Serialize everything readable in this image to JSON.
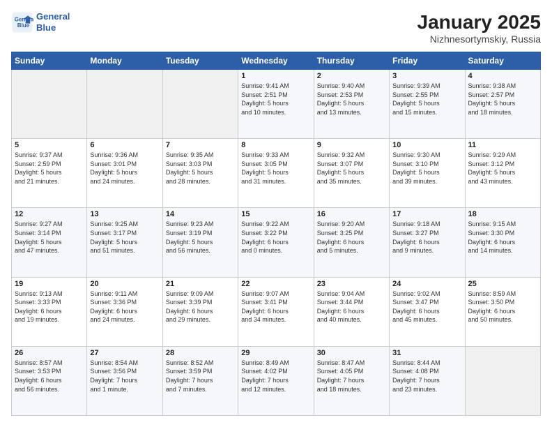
{
  "logo": {
    "line1": "General",
    "line2": "Blue"
  },
  "title": "January 2025",
  "subtitle": "Nizhnesortymskiy, Russia",
  "weekdays": [
    "Sunday",
    "Monday",
    "Tuesday",
    "Wednesday",
    "Thursday",
    "Friday",
    "Saturday"
  ],
  "weeks": [
    [
      {
        "day": "",
        "info": ""
      },
      {
        "day": "",
        "info": ""
      },
      {
        "day": "",
        "info": ""
      },
      {
        "day": "1",
        "info": "Sunrise: 9:41 AM\nSunset: 2:51 PM\nDaylight: 5 hours\nand 10 minutes."
      },
      {
        "day": "2",
        "info": "Sunrise: 9:40 AM\nSunset: 2:53 PM\nDaylight: 5 hours\nand 13 minutes."
      },
      {
        "day": "3",
        "info": "Sunrise: 9:39 AM\nSunset: 2:55 PM\nDaylight: 5 hours\nand 15 minutes."
      },
      {
        "day": "4",
        "info": "Sunrise: 9:38 AM\nSunset: 2:57 PM\nDaylight: 5 hours\nand 18 minutes."
      }
    ],
    [
      {
        "day": "5",
        "info": "Sunrise: 9:37 AM\nSunset: 2:59 PM\nDaylight: 5 hours\nand 21 minutes."
      },
      {
        "day": "6",
        "info": "Sunrise: 9:36 AM\nSunset: 3:01 PM\nDaylight: 5 hours\nand 24 minutes."
      },
      {
        "day": "7",
        "info": "Sunrise: 9:35 AM\nSunset: 3:03 PM\nDaylight: 5 hours\nand 28 minutes."
      },
      {
        "day": "8",
        "info": "Sunrise: 9:33 AM\nSunset: 3:05 PM\nDaylight: 5 hours\nand 31 minutes."
      },
      {
        "day": "9",
        "info": "Sunrise: 9:32 AM\nSunset: 3:07 PM\nDaylight: 5 hours\nand 35 minutes."
      },
      {
        "day": "10",
        "info": "Sunrise: 9:30 AM\nSunset: 3:10 PM\nDaylight: 5 hours\nand 39 minutes."
      },
      {
        "day": "11",
        "info": "Sunrise: 9:29 AM\nSunset: 3:12 PM\nDaylight: 5 hours\nand 43 minutes."
      }
    ],
    [
      {
        "day": "12",
        "info": "Sunrise: 9:27 AM\nSunset: 3:14 PM\nDaylight: 5 hours\nand 47 minutes."
      },
      {
        "day": "13",
        "info": "Sunrise: 9:25 AM\nSunset: 3:17 PM\nDaylight: 5 hours\nand 51 minutes."
      },
      {
        "day": "14",
        "info": "Sunrise: 9:23 AM\nSunset: 3:19 PM\nDaylight: 5 hours\nand 56 minutes."
      },
      {
        "day": "15",
        "info": "Sunrise: 9:22 AM\nSunset: 3:22 PM\nDaylight: 6 hours\nand 0 minutes."
      },
      {
        "day": "16",
        "info": "Sunrise: 9:20 AM\nSunset: 3:25 PM\nDaylight: 6 hours\nand 5 minutes."
      },
      {
        "day": "17",
        "info": "Sunrise: 9:18 AM\nSunset: 3:27 PM\nDaylight: 6 hours\nand 9 minutes."
      },
      {
        "day": "18",
        "info": "Sunrise: 9:15 AM\nSunset: 3:30 PM\nDaylight: 6 hours\nand 14 minutes."
      }
    ],
    [
      {
        "day": "19",
        "info": "Sunrise: 9:13 AM\nSunset: 3:33 PM\nDaylight: 6 hours\nand 19 minutes."
      },
      {
        "day": "20",
        "info": "Sunrise: 9:11 AM\nSunset: 3:36 PM\nDaylight: 6 hours\nand 24 minutes."
      },
      {
        "day": "21",
        "info": "Sunrise: 9:09 AM\nSunset: 3:39 PM\nDaylight: 6 hours\nand 29 minutes."
      },
      {
        "day": "22",
        "info": "Sunrise: 9:07 AM\nSunset: 3:41 PM\nDaylight: 6 hours\nand 34 minutes."
      },
      {
        "day": "23",
        "info": "Sunrise: 9:04 AM\nSunset: 3:44 PM\nDaylight: 6 hours\nand 40 minutes."
      },
      {
        "day": "24",
        "info": "Sunrise: 9:02 AM\nSunset: 3:47 PM\nDaylight: 6 hours\nand 45 minutes."
      },
      {
        "day": "25",
        "info": "Sunrise: 8:59 AM\nSunset: 3:50 PM\nDaylight: 6 hours\nand 50 minutes."
      }
    ],
    [
      {
        "day": "26",
        "info": "Sunrise: 8:57 AM\nSunset: 3:53 PM\nDaylight: 6 hours\nand 56 minutes."
      },
      {
        "day": "27",
        "info": "Sunrise: 8:54 AM\nSunset: 3:56 PM\nDaylight: 7 hours\nand 1 minute."
      },
      {
        "day": "28",
        "info": "Sunrise: 8:52 AM\nSunset: 3:59 PM\nDaylight: 7 hours\nand 7 minutes."
      },
      {
        "day": "29",
        "info": "Sunrise: 8:49 AM\nSunset: 4:02 PM\nDaylight: 7 hours\nand 12 minutes."
      },
      {
        "day": "30",
        "info": "Sunrise: 8:47 AM\nSunset: 4:05 PM\nDaylight: 7 hours\nand 18 minutes."
      },
      {
        "day": "31",
        "info": "Sunrise: 8:44 AM\nSunset: 4:08 PM\nDaylight: 7 hours\nand 23 minutes."
      },
      {
        "day": "",
        "info": ""
      }
    ]
  ]
}
